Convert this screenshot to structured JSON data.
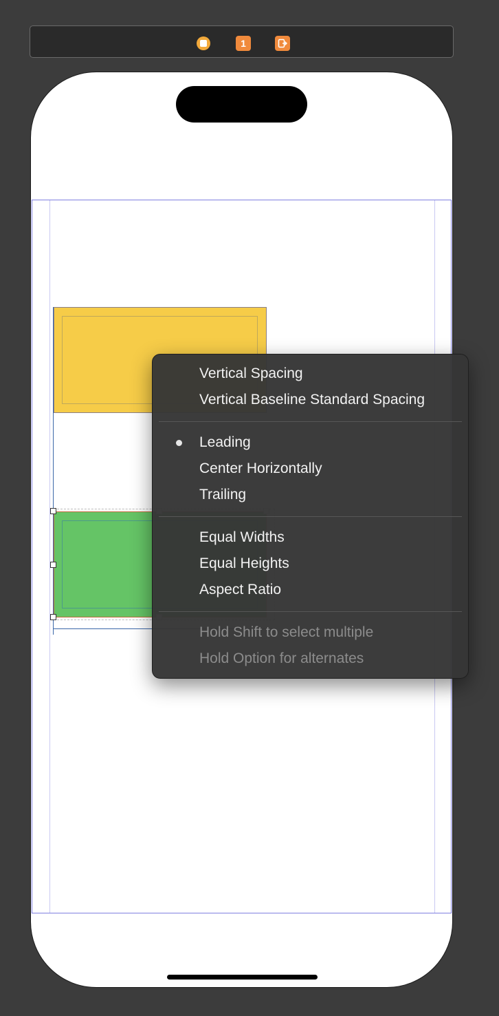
{
  "scene_dock": {
    "view_controller_icon": "view-controller-icon",
    "first_responder_icon": "first-responder-icon",
    "first_responder_label": "1",
    "exit_icon": "exit-icon"
  },
  "colors": {
    "canvas_background": "#3c3c3c",
    "yellow_view": "#f6cc48",
    "green_view": "#65c466",
    "menu_background": "#363636",
    "dock_accent": "#f08a3c"
  },
  "constraint_menu": {
    "groups": [
      [
        {
          "label": "Vertical Spacing",
          "checked": false,
          "enabled": true
        },
        {
          "label": "Vertical Baseline Standard Spacing",
          "checked": false,
          "enabled": true
        }
      ],
      [
        {
          "label": "Leading",
          "checked": true,
          "enabled": true
        },
        {
          "label": "Center Horizontally",
          "checked": false,
          "enabled": true
        },
        {
          "label": "Trailing",
          "checked": false,
          "enabled": true
        }
      ],
      [
        {
          "label": "Equal Widths",
          "checked": false,
          "enabled": true
        },
        {
          "label": "Equal Heights",
          "checked": false,
          "enabled": true
        },
        {
          "label": "Aspect Ratio",
          "checked": false,
          "enabled": true
        }
      ],
      [
        {
          "label": "Hold Shift to select multiple",
          "checked": false,
          "enabled": false
        },
        {
          "label": "Hold Option for alternates",
          "checked": false,
          "enabled": false
        }
      ]
    ]
  }
}
